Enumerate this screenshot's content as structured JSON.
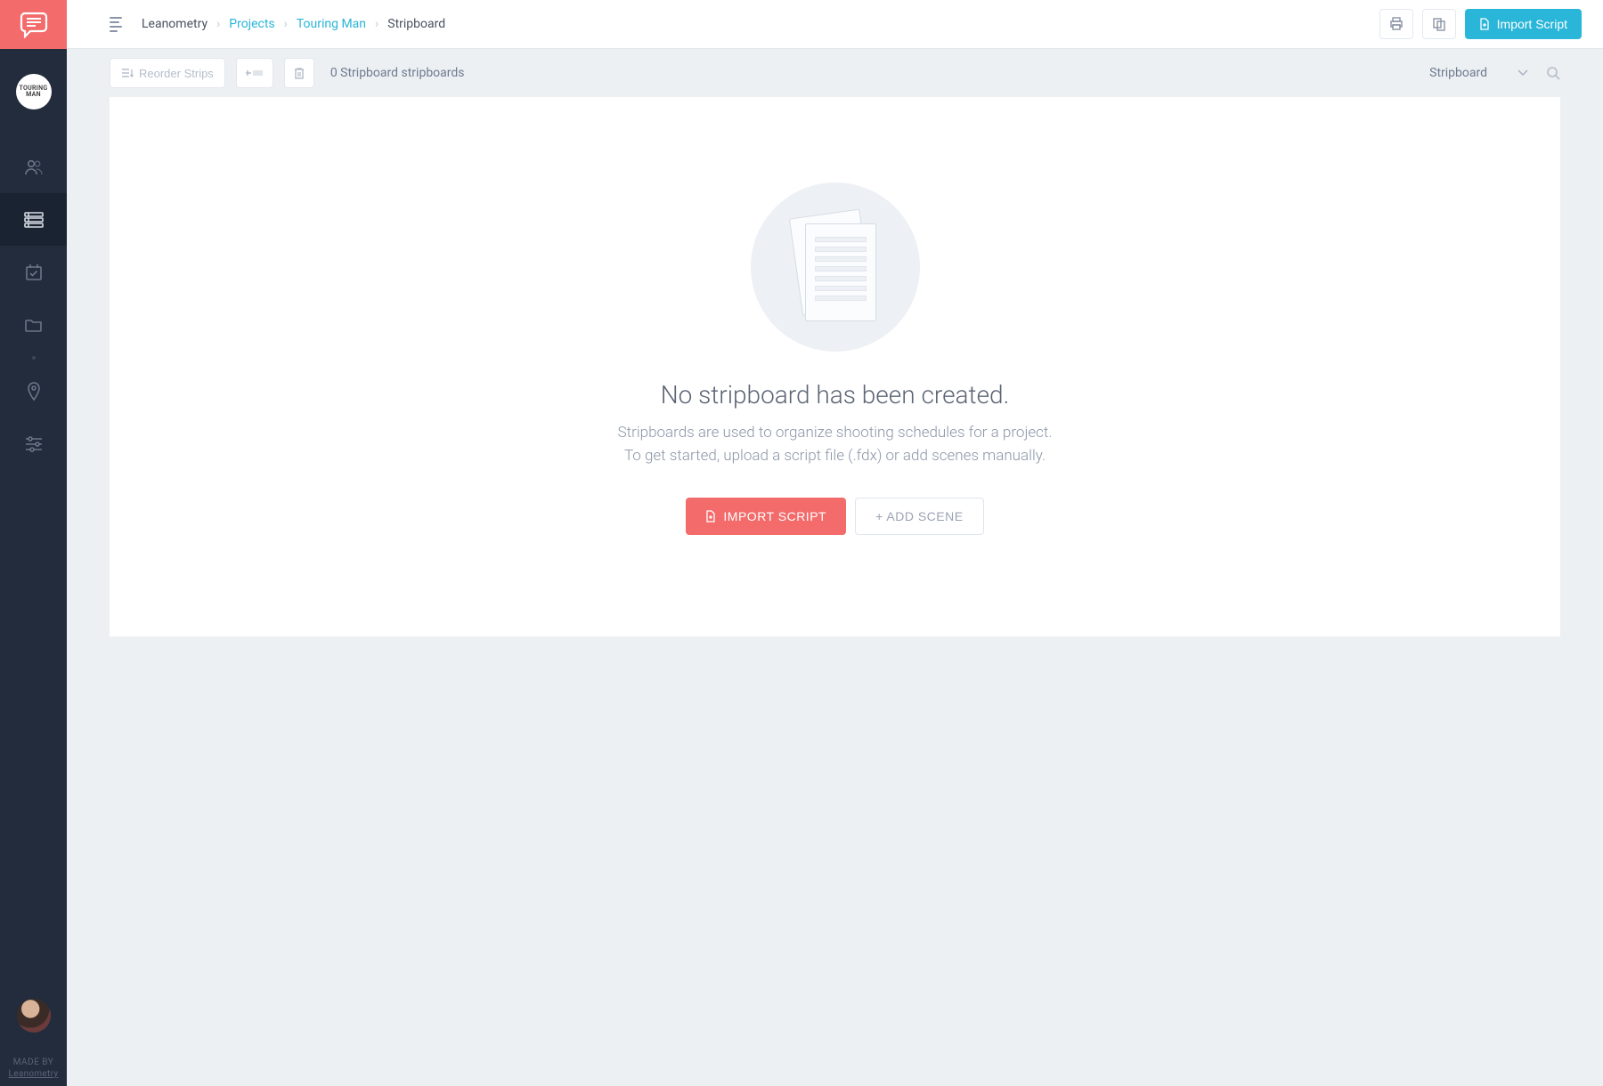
{
  "project_avatar_text": "TOURING\nMAN",
  "breadcrumb": {
    "org": "Leanometry",
    "projects": "Projects",
    "project": "Touring Man",
    "page": "Stripboard"
  },
  "topbar": {
    "import_label": "Import Script"
  },
  "toolbar": {
    "reorder_label": "Reorder Strips",
    "count_text": "0 Stripboard stripboards",
    "dropdown_label": "Stripboard"
  },
  "empty": {
    "title": "No stripboard has been created.",
    "desc_line1": "Stripboards are used to organize shooting schedules for a project.",
    "desc_line2": "To get started, upload a script file (.fdx) or add scenes manually.",
    "import_btn": "IMPORT SCRIPT",
    "add_btn": "+ ADD SCENE"
  },
  "footer": {
    "label": "MADE BY",
    "brand": "Leanometry"
  }
}
